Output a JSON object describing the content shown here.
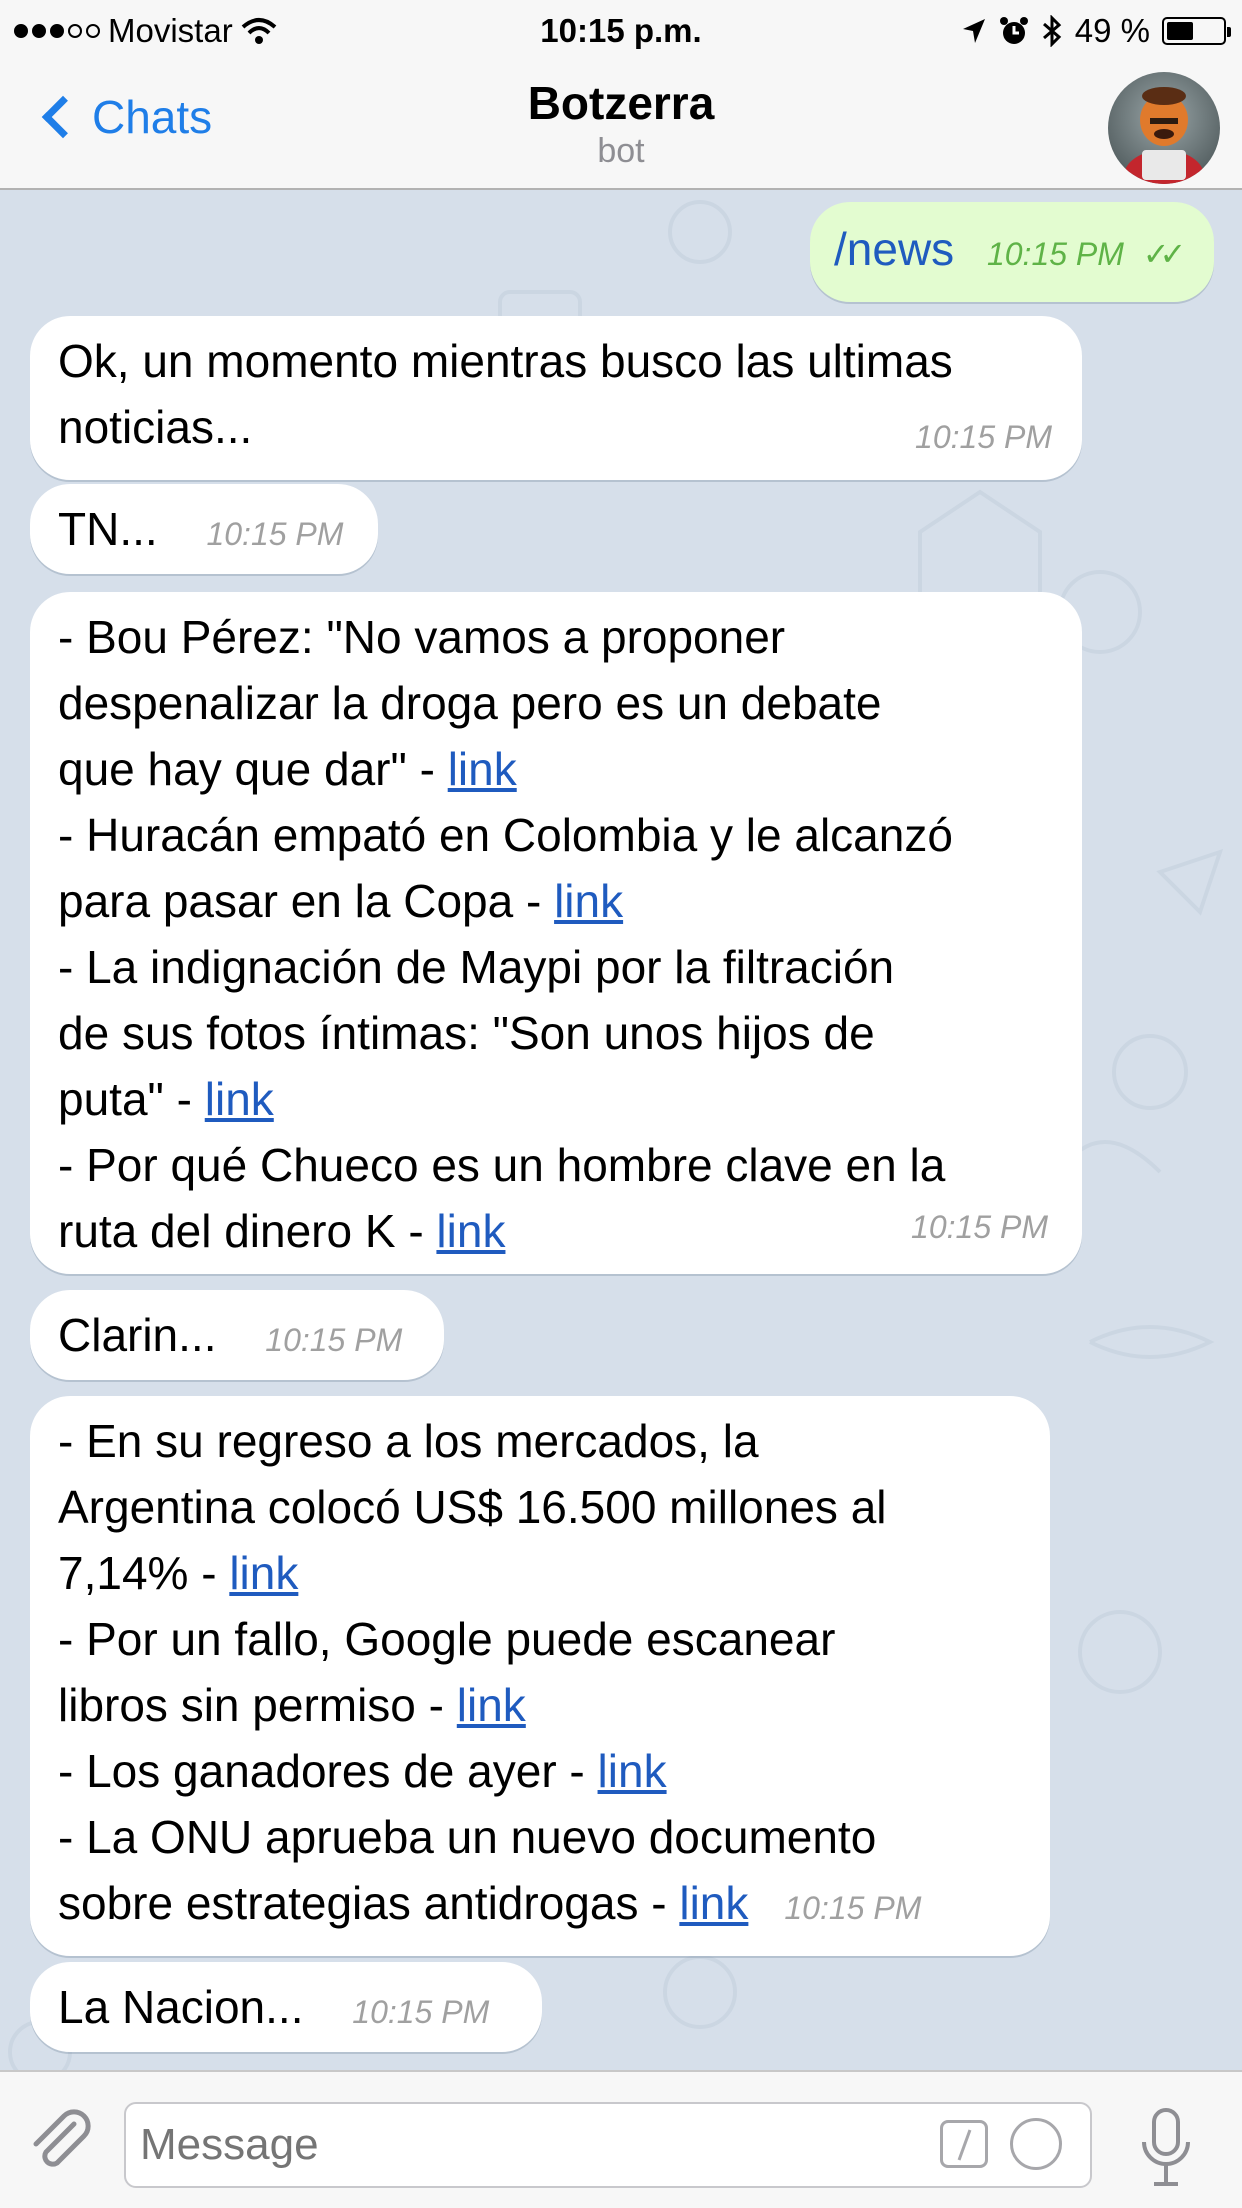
{
  "status_bar": {
    "carrier": "Movistar",
    "time": "10:15 p.m.",
    "battery": "49 %",
    "battery_level": 0.49
  },
  "nav": {
    "back_label": "Chats",
    "title": "Botzerra",
    "subtitle": "bot"
  },
  "messages": {
    "m0": {
      "text": "/news",
      "time": "10:15 PM"
    },
    "m1": {
      "lines": [
        "Ok, un momento mientras busco las ultimas",
        "noticias..."
      ],
      "time": "10:15 PM"
    },
    "m2": {
      "text": "TN...",
      "time": "10:15 PM"
    },
    "m3": {
      "lines": [
        "- Bou Pérez: \"No vamos a proponer",
        "despenalizar la droga pero es un debate",
        "que hay que dar\" - ",
        "- Huracán empató en Colombia y le alcanzó",
        "para pasar en la Copa - ",
        "- La indignación de Maypi por la filtración",
        "de sus fotos íntimas: \"Son unos hijos de",
        "puta\" - ",
        "- Por qué Chueco es un hombre clave en la",
        "ruta del dinero K - "
      ],
      "link": "link",
      "time": "10:15 PM"
    },
    "m4": {
      "text": "Clarin...",
      "time": "10:15 PM"
    },
    "m5": {
      "lines": [
        "- En su regreso a los mercados, la",
        "Argentina colocó US$ 16.500 millones al",
        "7,14% - ",
        "- Por un fallo, Google puede escanear",
        "libros sin permiso - ",
        "- Los ganadores de ayer - ",
        "- La ONU aprueba un nuevo documento",
        "sobre estrategias antidrogas - "
      ],
      "link": "link",
      "time": "10:15 PM"
    },
    "m6": {
      "text": "La Nacion...",
      "time": "10:15 PM"
    }
  },
  "input": {
    "placeholder": "Message"
  },
  "colors": {
    "accent": "#1f7ee8",
    "link": "#1f5bbf",
    "outgoing_bubble": "#e3fcd0",
    "chat_background": "#d6dfea"
  },
  "icons": [
    "signal-icon",
    "wifi-icon",
    "location-icon",
    "alarm-icon",
    "bluetooth-icon",
    "battery-icon",
    "back-chevron-icon",
    "paperclip-icon",
    "command-icon",
    "sticker-icon",
    "microphone-icon",
    "double-check-icon"
  ]
}
